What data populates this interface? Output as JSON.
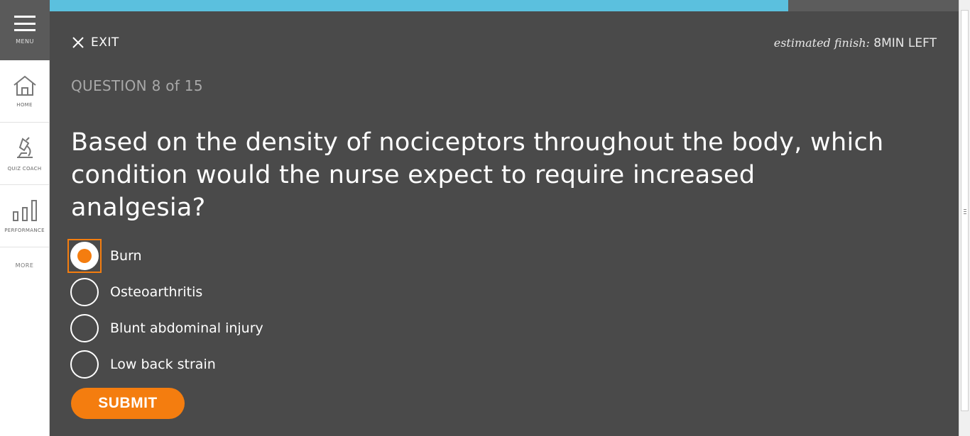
{
  "sidebar": {
    "menu_label": "MENU",
    "items": [
      {
        "label": "HOME",
        "icon": "home-icon"
      },
      {
        "label": "QUIZ COACH",
        "icon": "microscope-icon"
      },
      {
        "label": "PERFORMANCE",
        "icon": "bar-chart-icon"
      }
    ],
    "more_label": "MORE"
  },
  "progress": {
    "fraction": 0.8125
  },
  "header": {
    "exit_label": "EXIT",
    "finish_prefix": "estimated finish:",
    "finish_value": "8MIN LEFT"
  },
  "question": {
    "number_label": "QUESTION 8 of 15",
    "text": "Based on the density of nociceptors throughout the body, which condition would the nurse expect to require increased analgesia?"
  },
  "options": [
    {
      "label": "Burn",
      "selected": true
    },
    {
      "label": "Osteoarthritis",
      "selected": false
    },
    {
      "label": "Blunt abdominal injury",
      "selected": false
    },
    {
      "label": "Low back strain",
      "selected": false
    }
  ],
  "submit_label": "SUBMIT",
  "colors": {
    "accent": "#f47d0f",
    "progress": "#5bc0de",
    "background": "#4a4a4a"
  }
}
